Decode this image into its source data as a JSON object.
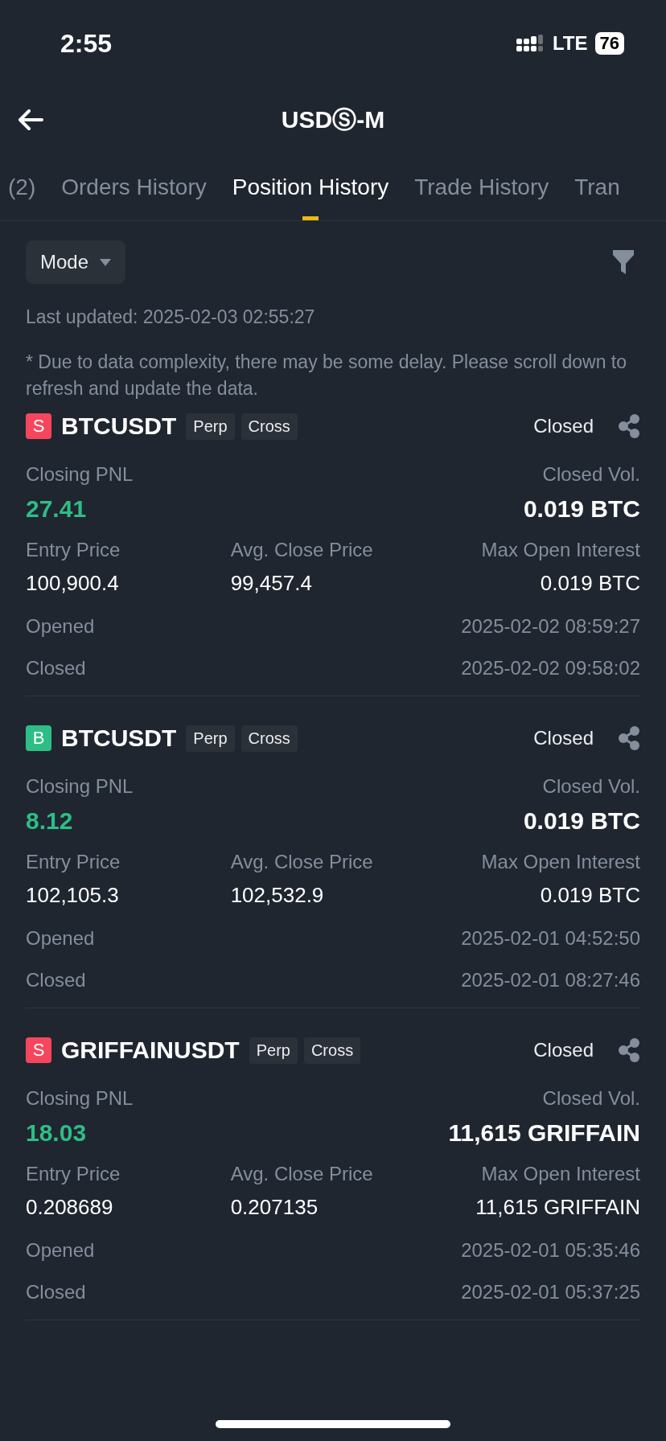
{
  "status_bar": {
    "time": "2:55",
    "network": "LTE",
    "battery": "76"
  },
  "header": {
    "title": "USDⓈ-M"
  },
  "tabs": [
    {
      "label": "(2)",
      "selected": false
    },
    {
      "label": "Orders History",
      "selected": false
    },
    {
      "label": "Position History",
      "selected": true
    },
    {
      "label": "Trade History",
      "selected": false
    },
    {
      "label": "Tran",
      "selected": false
    }
  ],
  "toolbar": {
    "mode": "Mode"
  },
  "last_updated": "Last updated: 2025-02-03 02:55:27",
  "notice": "* Due to data complexity, there may be some delay. Please scroll down to refresh and update the data.",
  "positions": [
    {
      "side": "S",
      "color": "#f6465d",
      "symbol": "BTCUSDT",
      "tags": [
        "Perp",
        "Cross"
      ],
      "status": "Closed",
      "pnl_label": "Closing PNL",
      "pnl": "27.41",
      "vol_label": "Closed Vol.",
      "vol": "0.019 BTC",
      "entry_label": "Entry Price",
      "entry": "100,900.4",
      "avg_label": "Avg. Close Price",
      "avg": "99,457.4",
      "max_label": "Max Open Interest",
      "max": "0.019 BTC",
      "opened_label": "Opened",
      "opened": "2025-02-02 08:59:27",
      "closed_label": "Closed",
      "closed": "2025-02-02 09:58:02"
    },
    {
      "side": "B",
      "color": "#2ebd85",
      "symbol": "BTCUSDT",
      "tags": [
        "Perp",
        "Cross"
      ],
      "status": "Closed",
      "pnl_label": "Closing PNL",
      "pnl": "8.12",
      "vol_label": "Closed Vol.",
      "vol": "0.019 BTC",
      "entry_label": "Entry Price",
      "entry": "102,105.3",
      "avg_label": "Avg. Close Price",
      "avg": "102,532.9",
      "max_label": "Max Open Interest",
      "max": "0.019 BTC",
      "opened_label": "Opened",
      "opened": "2025-02-01 04:52:50",
      "closed_label": "Closed",
      "closed": "2025-02-01 08:27:46"
    },
    {
      "side": "S",
      "color": "#f6465d",
      "symbol": "GRIFFAINUSDT",
      "tags": [
        "Perp",
        "Cross"
      ],
      "status": "Closed",
      "pnl_label": "Closing PNL",
      "pnl": "18.03",
      "vol_label": "Closed Vol.",
      "vol": "11,615 GRIFFAIN",
      "entry_label": "Entry Price",
      "entry": "0.208689",
      "avg_label": "Avg. Close Price",
      "avg": "0.207135",
      "max_label": "Max Open Interest",
      "max": "11,615 GRIFFAIN",
      "opened_label": "Opened",
      "opened": "2025-02-01 05:35:46",
      "closed_label": "Closed",
      "closed": "2025-02-01 05:37:25"
    }
  ]
}
